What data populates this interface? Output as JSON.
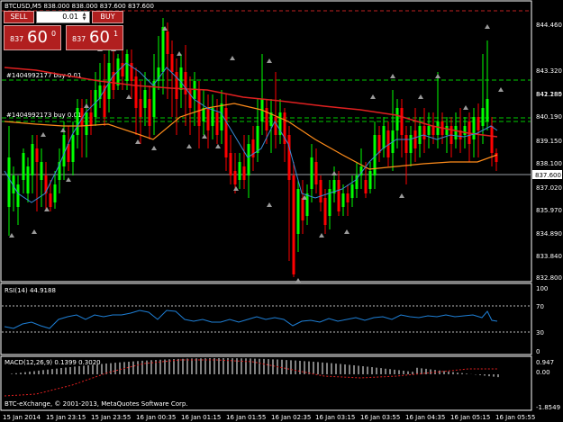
{
  "symbol_header": "BTCUSD,M5  838.000 838.000 837.600 837.600",
  "trade_panel": {
    "sell_label": "SELL",
    "buy_label": "BUY",
    "lot_value": "0.01",
    "sell_price_small": "837",
    "sell_price_big": "60",
    "sell_price_sup": "0",
    "buy_price_small": "837",
    "buy_price_big": "60",
    "buy_price_sup": "1"
  },
  "order_labels": [
    "#1404992177 buy 0.01",
    "#1404992173 buy 0.01"
  ],
  "price_axis": [
    "844.460",
    "843.320",
    "842.180",
    "841.285",
    "840.190",
    "839.150",
    "838.100",
    "837.020",
    "835.970",
    "834.890",
    "833.840",
    "832.800"
  ],
  "current_price": "837.600",
  "rsi": {
    "label": "RSI(14) 44.9188",
    "value": 44.9188,
    "axis": [
      "100",
      "70",
      "30",
      "0"
    ],
    "levels": [
      70,
      30
    ]
  },
  "macd": {
    "label": "MACD(12,26,9) 0.1399 0.3020",
    "axis": [
      "0.947",
      "0.00",
      "-1.8549"
    ]
  },
  "copyright": "BTC-eXchange, © 2001-2013, MetaQuotes Software Corp.",
  "time_axis": [
    "15 Jan 2014",
    "15 Jan 23:15",
    "15 Jan 23:55",
    "16 Jan 00:35",
    "16 Jan 01:15",
    "16 Jan 01:55",
    "16 Jan 02:35",
    "16 Jan 03:15",
    "16 Jan 03:55",
    "16 Jan 04:35",
    "16 Jan 05:15",
    "16 Jan 05:55"
  ],
  "colors": {
    "bull": "#00ff00",
    "bear": "#ff0000",
    "ma_fast": "#3a8ad6",
    "ma_mid": "#ff8c1a",
    "ma_slow": "#e02020",
    "rsi_line": "#1e7fd6",
    "order_line": "#00cc00",
    "grid": "#ffffff"
  }
}
